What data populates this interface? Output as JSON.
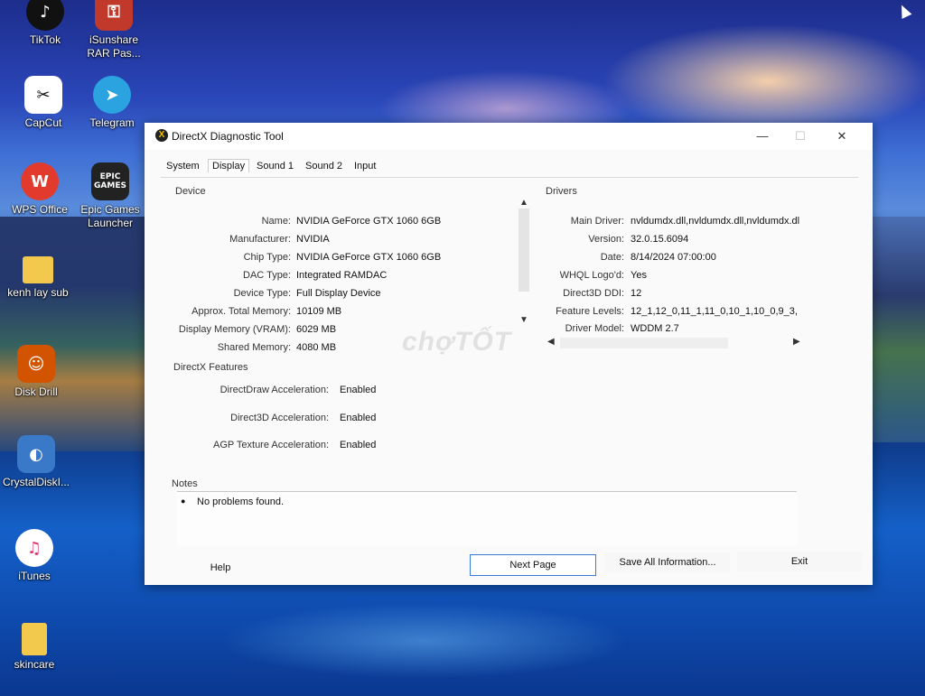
{
  "desktop": {
    "icons": [
      {
        "label": "TikTok"
      },
      {
        "label": "iSunshare\nRAR Pas..."
      },
      {
        "label": "CapCut"
      },
      {
        "label": "Telegram"
      },
      {
        "label": "WPS Office"
      },
      {
        "label": "Epic Games\nLauncher"
      },
      {
        "label": "kenh lay sub"
      },
      {
        "label": "Disk Drill"
      },
      {
        "label": "CrystalDiskI..."
      },
      {
        "label": "iTunes"
      },
      {
        "label": "skincare"
      }
    ],
    "icon_glyphs": {
      "epic": "EPIC\nGAMES",
      "wps": "W"
    }
  },
  "window": {
    "title": "DirectX Diagnostic Tool",
    "controls": {
      "minimize": "—",
      "maximize": "☐",
      "close": "✕"
    },
    "tabs": [
      "System",
      "Display",
      "Sound 1",
      "Sound 2",
      "Input"
    ],
    "active_tab": "Display",
    "device": {
      "title": "Device",
      "rows": [
        {
          "label": "Name:",
          "value": "NVIDIA GeForce GTX 1060 6GB"
        },
        {
          "label": "Manufacturer:",
          "value": "NVIDIA"
        },
        {
          "label": "Chip Type:",
          "value": "NVIDIA GeForce GTX 1060 6GB"
        },
        {
          "label": "DAC Type:",
          "value": "Integrated RAMDAC"
        },
        {
          "label": "Device Type:",
          "value": "Full Display Device"
        },
        {
          "label": "Approx. Total Memory:",
          "value": "10109 MB"
        },
        {
          "label": "Display Memory (VRAM):",
          "value": "6029 MB"
        },
        {
          "label": "Shared Memory:",
          "value": "4080 MB"
        }
      ]
    },
    "drivers": {
      "title": "Drivers",
      "rows": [
        {
          "label": "Main Driver:",
          "value": "nvldumdx.dll,nvldumdx.dll,nvldumdx.dl"
        },
        {
          "label": "Version:",
          "value": "32.0.15.6094"
        },
        {
          "label": "Date:",
          "value": "8/14/2024 07:00:00"
        },
        {
          "label": "WHQL Logo'd:",
          "value": "Yes"
        },
        {
          "label": "Direct3D DDI:",
          "value": "12"
        },
        {
          "label": "Feature Levels:",
          "value": "12_1,12_0,11_1,11_0,10_1,10_0,9_3,"
        },
        {
          "label": "Driver Model:",
          "value": "WDDM 2.7"
        }
      ]
    },
    "features": {
      "title": "DirectX Features",
      "rows": [
        {
          "label": "DirectDraw Acceleration:",
          "value": "Enabled"
        },
        {
          "label": "Direct3D Acceleration:",
          "value": "Enabled"
        },
        {
          "label": "AGP Texture Acceleration:",
          "value": "Enabled"
        }
      ]
    },
    "notes": {
      "title": "Notes",
      "items": [
        "No problems found."
      ]
    },
    "buttons": {
      "help": "Help",
      "next": "Next Page",
      "save": "Save All Information...",
      "exit": "Exit"
    },
    "watermark": "chợTỐT"
  }
}
